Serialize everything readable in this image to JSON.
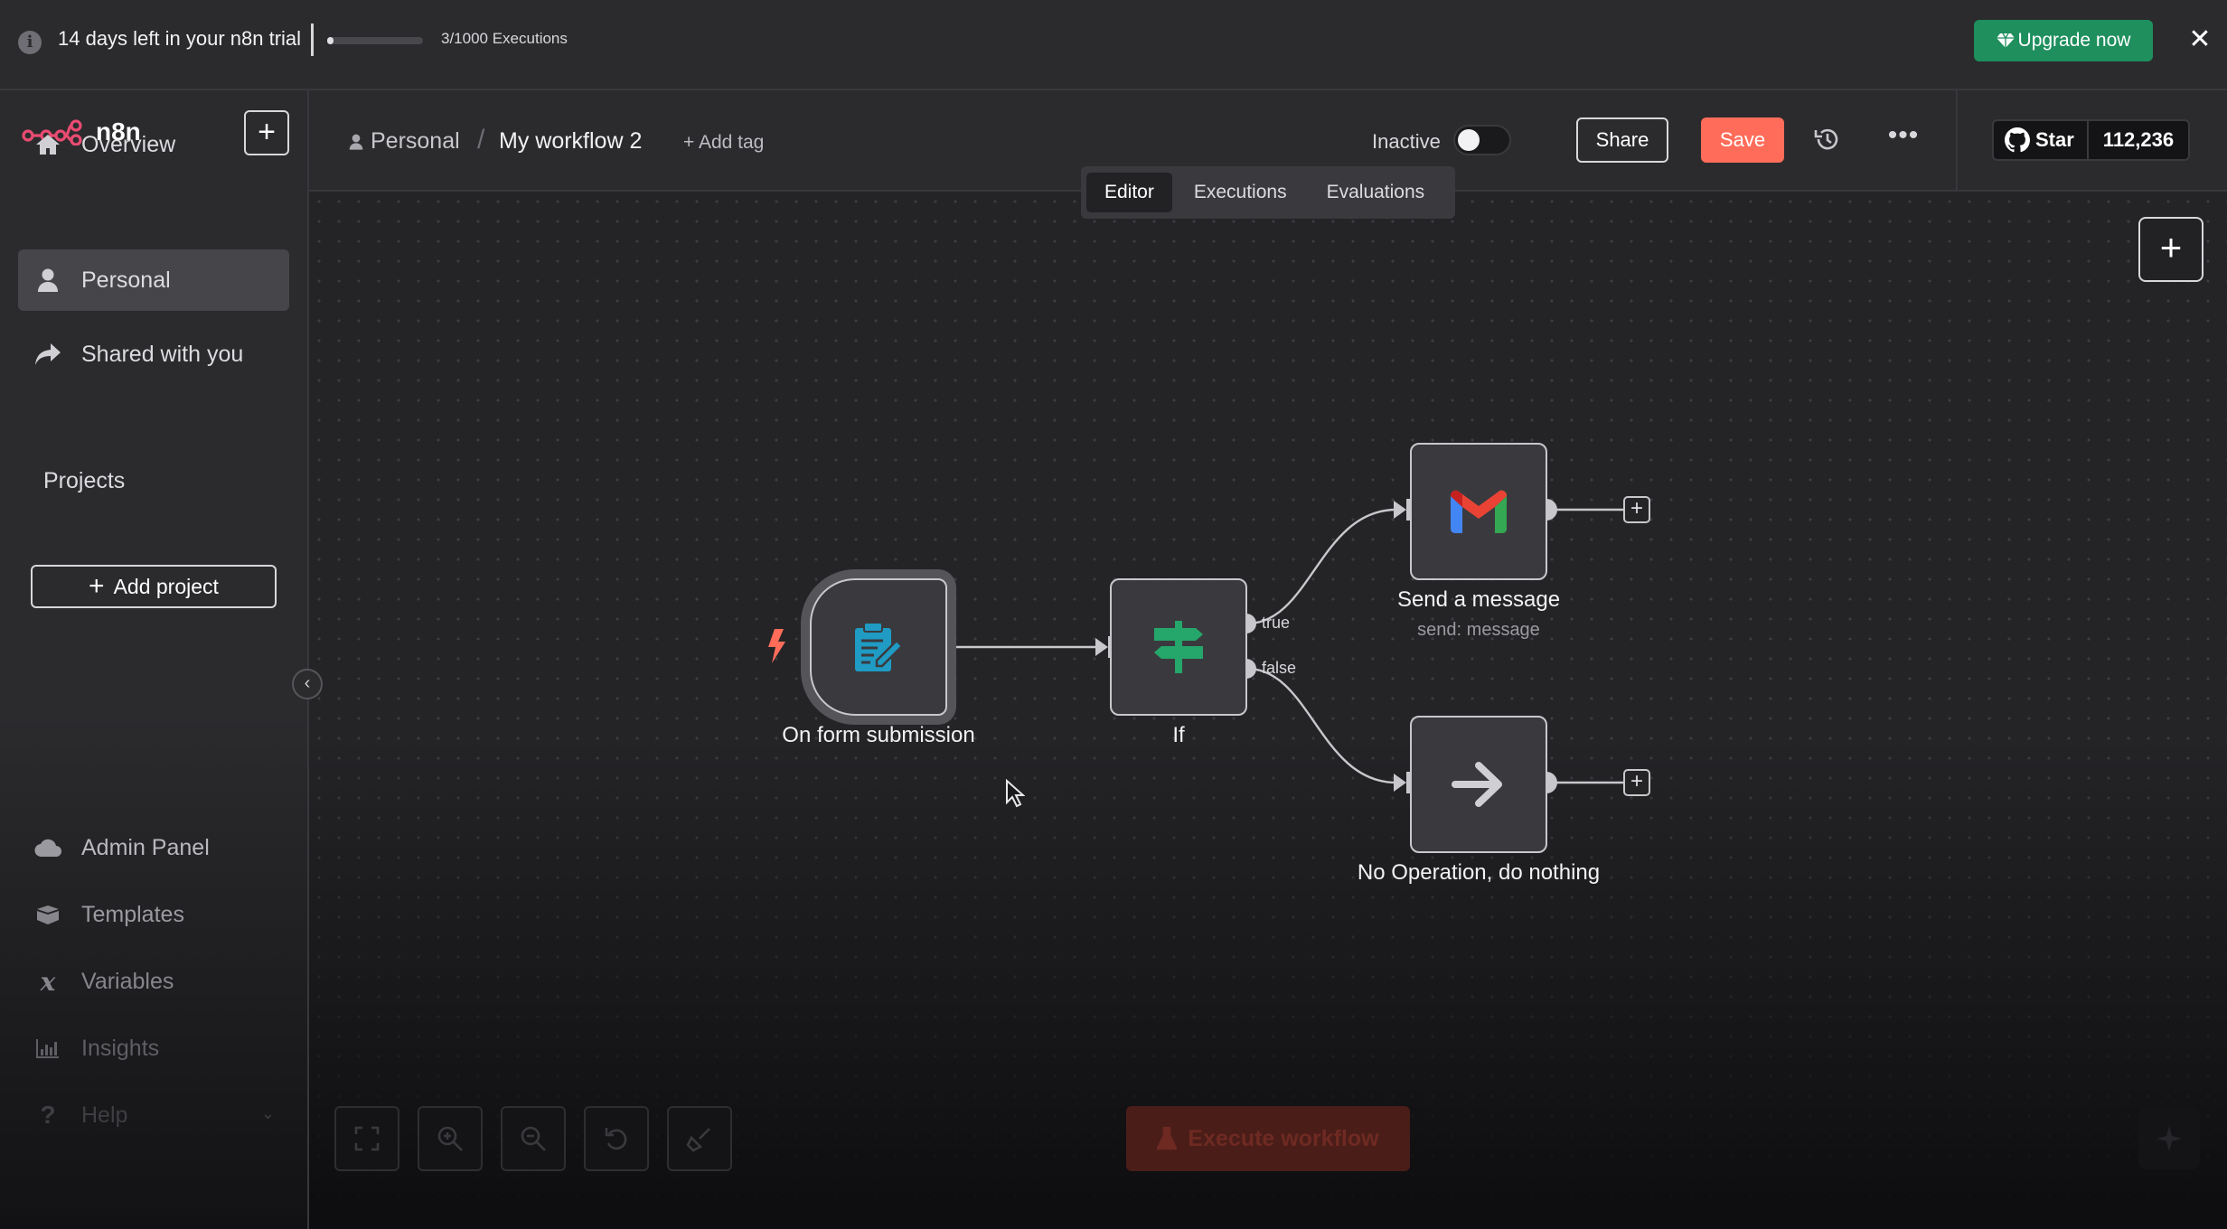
{
  "banner": {
    "trial_text": "14 days left in your n8n trial",
    "executions_used": 3,
    "executions_total": 1000,
    "executions_text": "3/1000 Executions",
    "upgrade_label": "Upgrade now",
    "upgrade_color": "#1e8f5d"
  },
  "sidebar": {
    "brand": "n8n",
    "nav": [
      {
        "label": "Overview",
        "icon": "home-icon"
      },
      {
        "label": "Personal",
        "icon": "user-icon",
        "active": true
      },
      {
        "label": "Shared with you",
        "icon": "share-icon"
      }
    ],
    "projects_title": "Projects",
    "add_project_label": "Add project",
    "lower_nav": [
      {
        "label": "Admin Panel",
        "icon": "cloud-icon"
      },
      {
        "label": "Templates",
        "icon": "box-icon"
      },
      {
        "label": "Variables",
        "icon": "variable-icon"
      },
      {
        "label": "Insights",
        "icon": "chart-icon"
      },
      {
        "label": "Help",
        "icon": "help-icon"
      }
    ]
  },
  "header": {
    "breadcrumb_project": "Personal",
    "workflow_name": "My workflow 2",
    "add_tag_label": "+ Add tag",
    "status_label": "Inactive",
    "active": false,
    "share_label": "Share",
    "save_label": "Save",
    "save_color": "#ff6d5a",
    "github_star_label": "Star",
    "github_star_count": "112,236"
  },
  "tabs": [
    {
      "label": "Editor",
      "active": true
    },
    {
      "label": "Executions",
      "active": false
    },
    {
      "label": "Evaluations",
      "active": false
    }
  ],
  "nodes": {
    "form": {
      "label": "On form submission",
      "icon": "form-icon"
    },
    "if": {
      "label": "If",
      "icon": "signpost-icon",
      "true_label": "true",
      "false_label": "false"
    },
    "gmail": {
      "label": "Send a message",
      "subtitle": "send: message",
      "icon": "gmail-icon"
    },
    "noop": {
      "label": "No Operation, do nothing",
      "icon": "arrow-right-icon"
    }
  },
  "toolbar": {
    "execute_label": "Execute workflow"
  }
}
